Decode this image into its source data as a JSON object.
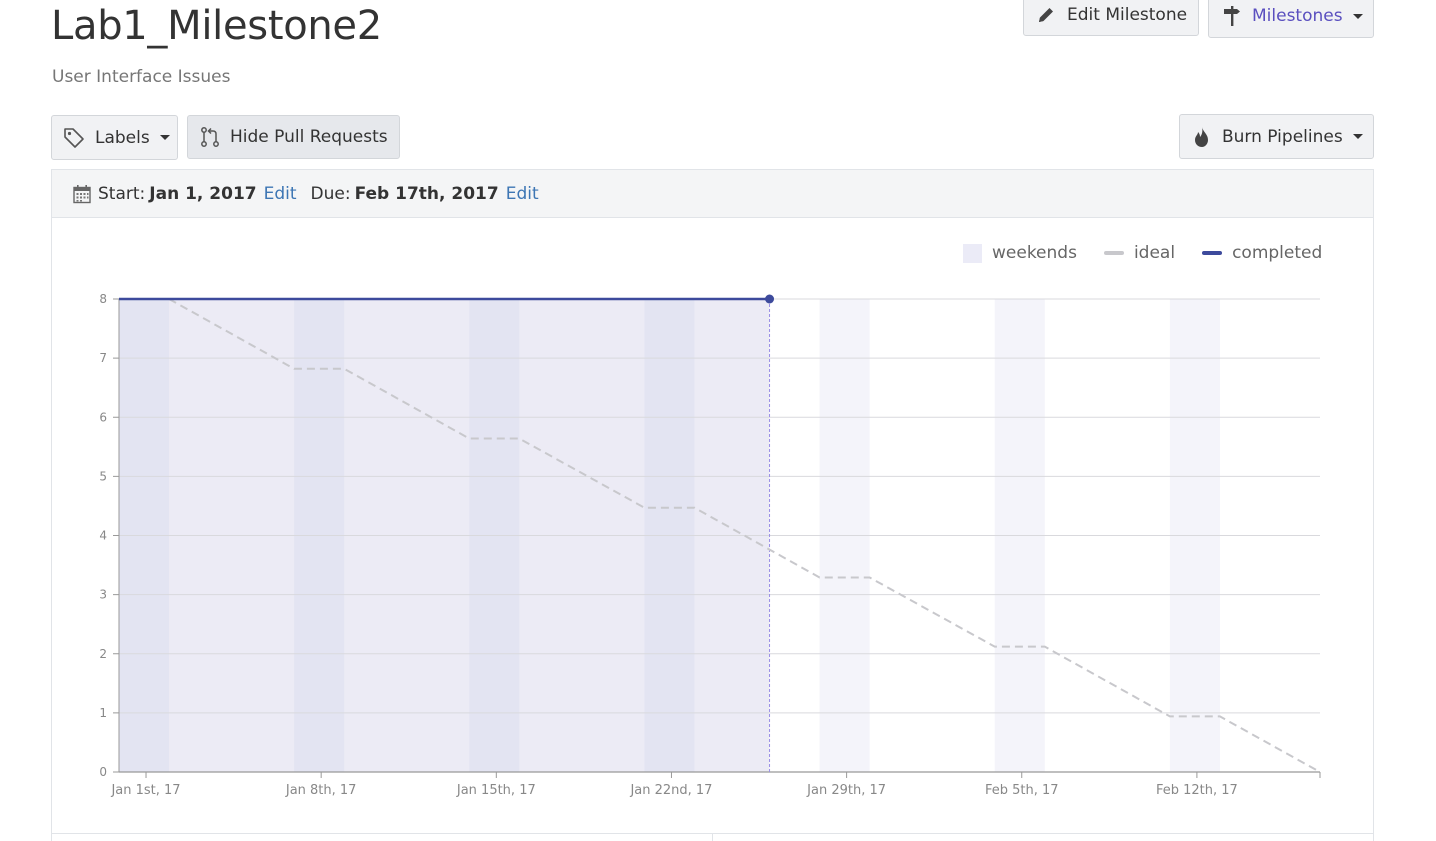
{
  "milestone": {
    "title": "Lab1_Milestone2",
    "subtitle": "User Interface Issues"
  },
  "header_actions": {
    "edit_label": "Edit Milestone",
    "milestones_label": "Milestones"
  },
  "toolbar": {
    "labels_label": "Labels",
    "hide_pr_label": "Hide Pull Requests",
    "burn_label": "Burn Pipelines"
  },
  "dates": {
    "start_prefix": "Start:",
    "start_value": "Jan 1, 2017",
    "due_prefix": "Due:",
    "due_value": "Feb 17th, 2017",
    "edit_label": "Edit"
  },
  "colors": {
    "accent": "#3d4a9c",
    "link": "#3d76b4",
    "ideal": "#c8c8cc",
    "weekend": "#ebebf7",
    "completed_fill": "#ecebf5",
    "milestones_text": "#5a4fbf"
  },
  "icons": {
    "edit": "pencil-icon",
    "milestones": "signpost-icon",
    "labels": "tag-icon",
    "pull_requests": "git-pull-request-icon",
    "burn": "flame-icon",
    "calendar": "calendar-icon"
  },
  "chart_data": {
    "type": "line",
    "legend": [
      "weekends",
      "ideal",
      "completed"
    ],
    "legend_position": "top-right",
    "grid": true,
    "x_tick_labels": [
      "Jan 1st, 17",
      "Jan 8th, 17",
      "Jan 15th, 17",
      "Jan 22nd, 17",
      "Jan 29th, 17",
      "Feb 5th, 17",
      "Feb 12th, 17"
    ],
    "x_tick_dates": [
      "2017-01-01",
      "2017-01-08",
      "2017-01-15",
      "2017-01-22",
      "2017-01-29",
      "2017-02-05",
      "2017-02-12"
    ],
    "xlim": [
      "2016-12-31",
      "2017-02-17"
    ],
    "ylim": [
      0,
      8
    ],
    "y_ticks": [
      0,
      1,
      2,
      3,
      4,
      5,
      6,
      7,
      8
    ],
    "weekends": [
      {
        "start": "2016-12-31",
        "end": "2017-01-02"
      },
      {
        "start": "2017-01-07",
        "end": "2017-01-09"
      },
      {
        "start": "2017-01-14",
        "end": "2017-01-16"
      },
      {
        "start": "2017-01-21",
        "end": "2017-01-23"
      },
      {
        "start": "2017-01-28",
        "end": "2017-01-30"
      },
      {
        "start": "2017-02-04",
        "end": "2017-02-06"
      },
      {
        "start": "2017-02-11",
        "end": "2017-02-13"
      }
    ],
    "series": [
      {
        "name": "ideal",
        "style": "dashed",
        "points": [
          {
            "x": "2017-01-02",
            "y": 8
          },
          {
            "x": "2017-01-07",
            "y": 6.82
          },
          {
            "x": "2017-01-09",
            "y": 6.82
          },
          {
            "x": "2017-01-14",
            "y": 5.64
          },
          {
            "x": "2017-01-16",
            "y": 5.64
          },
          {
            "x": "2017-01-21",
            "y": 4.47
          },
          {
            "x": "2017-01-23",
            "y": 4.47
          },
          {
            "x": "2017-01-28",
            "y": 3.29
          },
          {
            "x": "2017-01-30",
            "y": 3.29
          },
          {
            "x": "2017-02-04",
            "y": 2.12
          },
          {
            "x": "2017-02-06",
            "y": 2.12
          },
          {
            "x": "2017-02-11",
            "y": 0.94
          },
          {
            "x": "2017-02-13",
            "y": 0.94
          },
          {
            "x": "2017-02-17",
            "y": 0
          }
        ]
      },
      {
        "name": "completed",
        "style": "solid",
        "points": [
          {
            "x": "2016-12-31",
            "y": 8
          },
          {
            "x": "2017-01-26",
            "y": 8
          }
        ]
      }
    ],
    "today": "2017-01-26"
  }
}
